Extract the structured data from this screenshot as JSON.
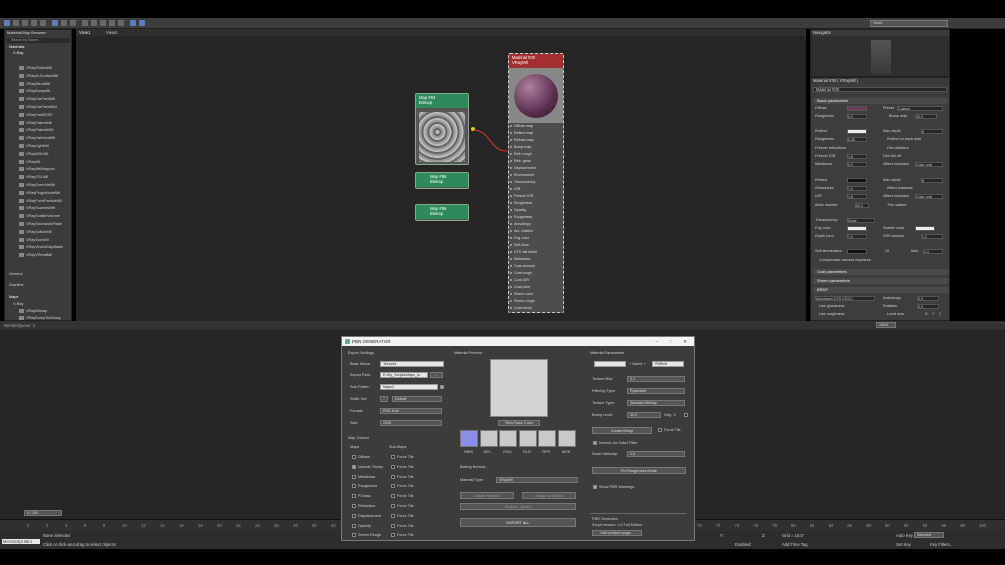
{
  "viewport_tabs": [
    "View1",
    "View2"
  ],
  "view_dropdown": "View1",
  "browser": {
    "title": "Material/Map Browser",
    "search_placeholder": "Search by Name ...",
    "sections": {
      "materials": "Materials",
      "vray": "V-Ray",
      "general": "General",
      "scanline": "Scanline",
      "maps": "Maps",
      "maps_vray": "V-Ray"
    },
    "items": [
      "VRay2SidedMtl",
      "VRayALSurfaceMtl",
      "VRayBlendMtl",
      "VRayBumpMtl",
      "VRayCarPaintMtl",
      "VRayCarPaintMtl2",
      "VRayFastSSS2",
      "VRayFlakesMtl",
      "VRayFlakesMtl2",
      "VRayHairNextMtl",
      "VRayLightMtl",
      "VRayMDLMtl",
      "VRayMtl",
      "VRayMtlWrapper",
      "VRayOSLMtl",
      "VRayOverrideMtl",
      "VRayPluginNodeMtl",
      "VRayPointParticleMtl",
      "VRayScannedMtl",
      "VRayScatterVolume",
      "VRayStochasticFlake",
      "VRaySwitchMtl",
      "VRayToonMtl",
      "VRayVectorDisplBake",
      "VRayVRmatMtl"
    ],
    "map_items": [
      "VRayBitmap",
      "VRayBumpToGlossy"
    ]
  },
  "nodes": {
    "material": {
      "title": "Material #30",
      "subtitle": "VRayMtl",
      "slots": [
        "Diffuse map",
        "Reflect map",
        "Refract map",
        "Bump map",
        "Refl. rough",
        "Refr. gloss",
        "Displacement",
        "Environment",
        "Translucency",
        "IOR",
        "Fresnel IOR",
        "Roughness",
        "Opacity",
        "Roughness",
        "Anisotropy",
        "Anl. rotation",
        "Fog color",
        "Self-illum",
        "GTR tail falloff",
        "Metalness",
        "Coat amount",
        "Coat rough",
        "Coat IOR",
        "Coat color",
        "Sheen color",
        "Sheen rough",
        "Coat bump"
      ]
    },
    "map94": {
      "title": "Map #94",
      "subtitle": "Bitmap"
    },
    "map95": {
      "title": "Map #95",
      "subtitle": "Bitmap"
    },
    "map96": {
      "title": "Map #96",
      "subtitle": "Bitmap"
    }
  },
  "navigator": {
    "title": "Navigator"
  },
  "material_panel": {
    "title": "Material #30 ( VRayMtl )",
    "name_field": "Material #30",
    "basic_params": "Basic parameters",
    "rows": {
      "diffuse": "Diffuse",
      "preset": "Preset",
      "preset_val": "Custom",
      "roughness": "Roughness",
      "roughness_val": "0,0",
      "bump_map": "Bump map",
      "bump_val": "30,0",
      "reflect": "Reflect",
      "max_depth": "Max depth",
      "max_depth_val": "8",
      "glossiness": "Roughness",
      "glossiness_val": "0,26",
      "refl_back": "Reflect on back side",
      "fresnel": "Fresnel reflections",
      "dim_distance": "Dim distance",
      "fresnel_ior": "Fresnel IOR",
      "fresnel_ior_val": "1,6",
      "dim_falloff": "Dim fall off",
      "metalness": "Metalness",
      "metalness_val": "0,0",
      "affect_channels": "Affect channels",
      "color_only": "Color only",
      "refract": "Refract",
      "max_depth2": "Max depth",
      "max_depth2_val": "8",
      "glossiness2": "Glossiness",
      "glossiness2_val": "1,0",
      "affect_shadows": "Affect shadows",
      "ior": "IOR",
      "ior_val": "1,6",
      "affect_channels2": "Affect channels",
      "color_only2": "Color only",
      "abbe": "Abbe number",
      "abbe_val": "50,0",
      "thin_walled": "Thin-walled",
      "translucency": "Translucency",
      "translucency_val": "None",
      "fog_color": "Fog color",
      "scatter_color": "Scatter color",
      "depth": "Depth (cm)",
      "depth_val": "1,0",
      "sss_amount": "SSS amount",
      "sss_val": "1,0",
      "self_illum": "Self-illumination",
      "gi": "GI",
      "mult": "Mult",
      "mult_val": "1,0",
      "comp_camera": "Compensate camera exposure"
    },
    "coat_params": "Coat parameters",
    "sheen_params": "Sheen parameters",
    "brdf": "BRDF",
    "brdf_rows": {
      "brdf_type": "Microfacet GTR (GGX)",
      "anisotropy": "Anisotropy",
      "anisotropy_val": "0,0",
      "use_glossiness": "Use glossiness",
      "rotation": "Rotation",
      "rotation_val": "0,0",
      "use_roughness": "Use roughness",
      "local_axis": "Local axis",
      "axis_x": "X",
      "axis_y": "Y",
      "axis_z": "Z"
    }
  },
  "zoom": "100%",
  "render_queue": "RenderQueue: 2",
  "timeline": {
    "frame": "0 / 100",
    "ticks": [
      "0",
      "2",
      "4",
      "6",
      "8",
      "10",
      "12",
      "14",
      "16",
      "18",
      "20",
      "22",
      "24",
      "26",
      "28",
      "30",
      "32"
    ],
    "ticks_right": [
      "70",
      "72",
      "74",
      "76",
      "78",
      "80",
      "82",
      "84",
      "86",
      "88",
      "90",
      "92",
      "94",
      "96",
      "98",
      "100"
    ]
  },
  "status": {
    "maxscript": "MAXScript Mini",
    "selection": "None Selected",
    "hint": "Click or click-and-drag to select objects",
    "y_label": "Y:",
    "z_label": "Z:",
    "grid": "Grid = 10,0\"",
    "enabled": "Enabled:",
    "add_time_tag": "Add Time Tag",
    "auto_key": "Auto Key",
    "selected": "Selected",
    "set_key": "Set Key",
    "key_filters": "Key Filters..."
  },
  "dialog": {
    "title": "PBR GENERATOR",
    "export_settings": "Export Settings",
    "base_name_label": "Base Name:",
    "base_name": "Texture1",
    "export_path_label": "Export Path:",
    "export_path": "E:/My_Scripts/Maps_to",
    "browse": "...",
    "sub_folder_label": "Sub-Folder:",
    "sub_folder": "Maps4",
    "suffix_label": "Suffix Set:",
    "suffix_val": "Default",
    "format_label": "Format:",
    "format_val": "PNG 8-bit",
    "size_label": "Size:",
    "size_val": "2048",
    "map_control": "Map Control",
    "maps_label": "Maps",
    "submaps_label": "Sub-Maps",
    "maps": [
      {
        "name": "Diffuse",
        "on": false,
        "force": "Force Tile"
      },
      {
        "name": "Normal / Bump",
        "on": true,
        "force": "Force Tile"
      },
      {
        "name": "Metalness",
        "on": false,
        "force": "Force Tile"
      },
      {
        "name": "Roughness",
        "on": false,
        "force": "Force Tile"
      },
      {
        "name": "P.Glass",
        "on": false,
        "force": "Force Tile"
      },
      {
        "name": "Refraction",
        "on": false,
        "force": "Force Tile"
      },
      {
        "name": "Displacement",
        "on": false,
        "force": "Force Tile"
      },
      {
        "name": "Opacity",
        "on": false,
        "force": "Force Tile"
      },
      {
        "name": "Sheen Rough",
        "on": false,
        "force": "Force Tile"
      }
    ],
    "material_preview": "Material Preview",
    "view_base_color": "View Base Color",
    "thumbs": [
      "NRM",
      "MTL",
      "ROU",
      "GLO",
      "RFR",
      "MSK"
    ],
    "baking": "Baking Normal...",
    "material_type_label": "Material Type:",
    "material_type": "VRayMtl",
    "create_material": "Create Material",
    "assign_to_object": "Assign to Object",
    "replace_mats": "Replace_(Mats)",
    "export_all": "EXPORT ALL",
    "material_params": "Material Parameters",
    "name_label": "+ Name +",
    "name_suffix": "PBRmtl",
    "texture_blur_label": "Texture Blur:",
    "texture_blur": "0,1",
    "filtering_label": "Filtering Type:",
    "filtering": "Pyramidal",
    "texture_type_label": "Texture Type:",
    "texture_type": "Standard Bitmap",
    "bump_level_label": "Bump Level:",
    "bump_level": "30,0",
    "orig_label": "Orig. V.",
    "create_bump": "Create Bump",
    "force_tile": "Force Tile",
    "normal_sobel": "Normal via Sobel Filter",
    "sobel_label": "Sobel Intensity:",
    "sobel_val": "1,0",
    "fix_roughness": "Fix Roughness Mode",
    "show_warnings": "Show PBR Warnings",
    "footer_title": "PBR Generator",
    "footer_version": "Script version: 1.0 Full Edition",
    "visit_page": "Visit product page..."
  }
}
